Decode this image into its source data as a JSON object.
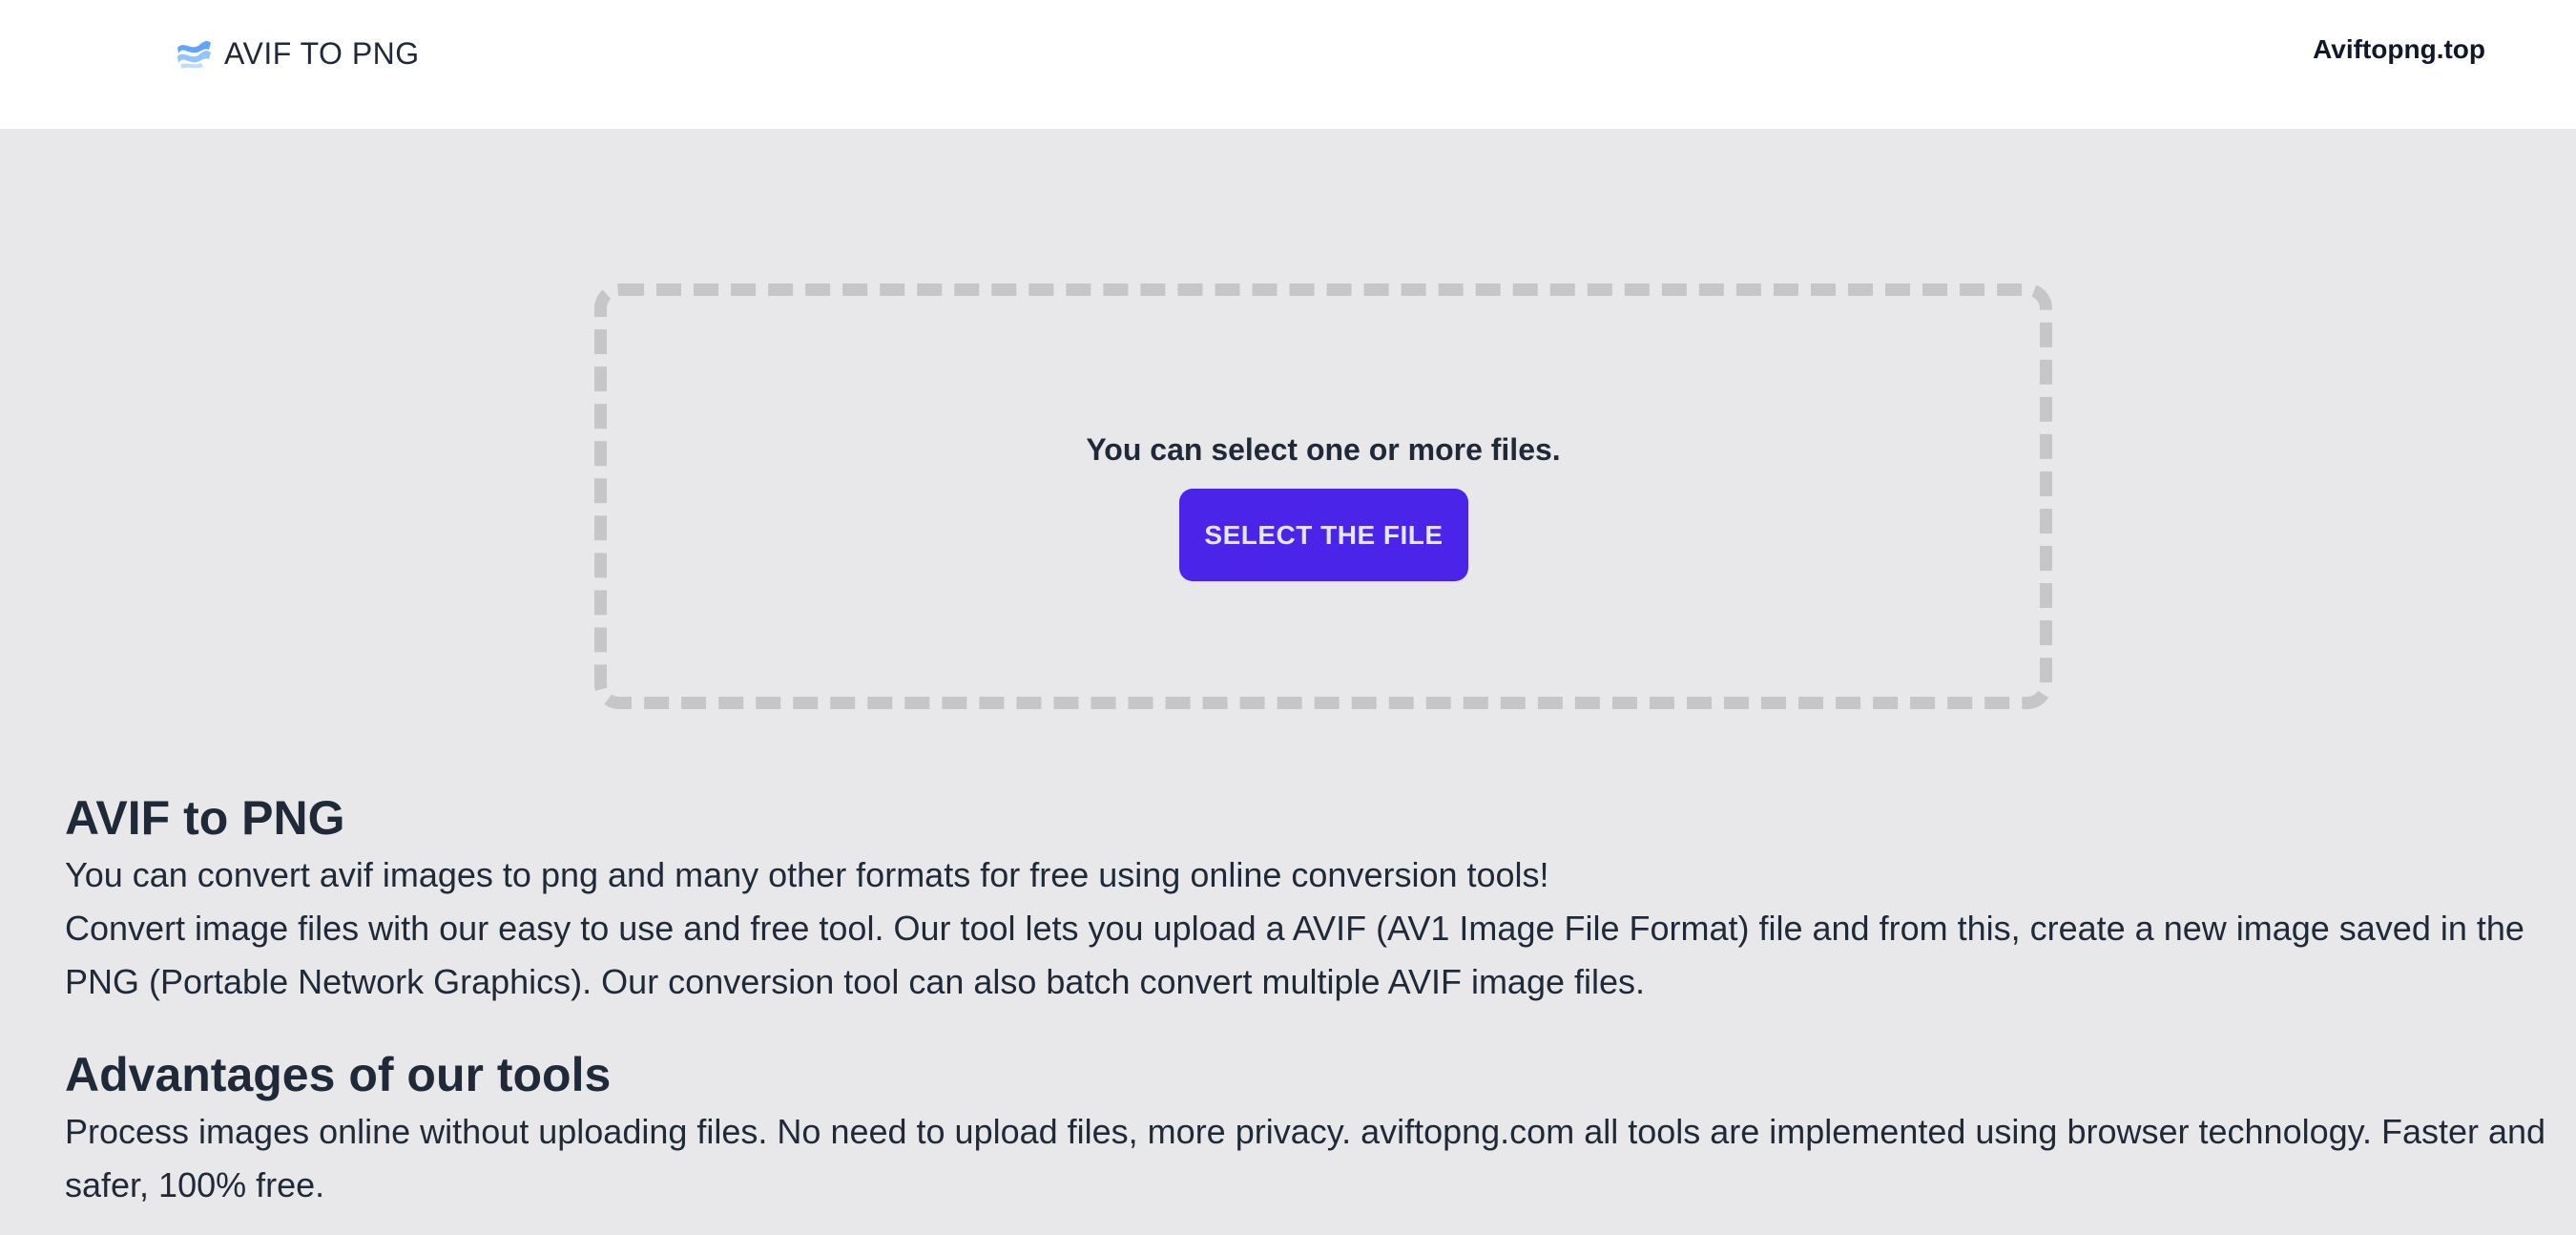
{
  "header": {
    "brand_icon": "wave-logo-icon",
    "brand_text": "AVIF TO PNG",
    "site_link": "Aviftopng.top"
  },
  "uploader": {
    "hint": "You can select one or more files.",
    "button_label": "SELECT THE FILE",
    "button_color": "#4a24e9",
    "border_color": "#c6c6c9"
  },
  "article": {
    "section1": {
      "title": "AVIF to PNG",
      "paragraph1": "You can convert avif images to png and many other formats for free using online conversion tools!",
      "paragraph2": "Convert image files with our easy to use and free tool. Our tool lets you upload a AVIF (AV1 Image File Format) file and from this, create a new image saved in the PNG (Portable Network Graphics). Our conversion tool can also batch convert multiple AVIF image files."
    },
    "section2": {
      "title": "Advantages of our tools",
      "paragraph1": "Process images online without uploading files. No need to upload files, more privacy. aviftopng.com all tools are implemented using browser technology. Faster and safer, 100% free."
    }
  },
  "colors": {
    "page_background": "#e8e8eb",
    "header_background": "#ffffff",
    "text": "#1f2937"
  }
}
